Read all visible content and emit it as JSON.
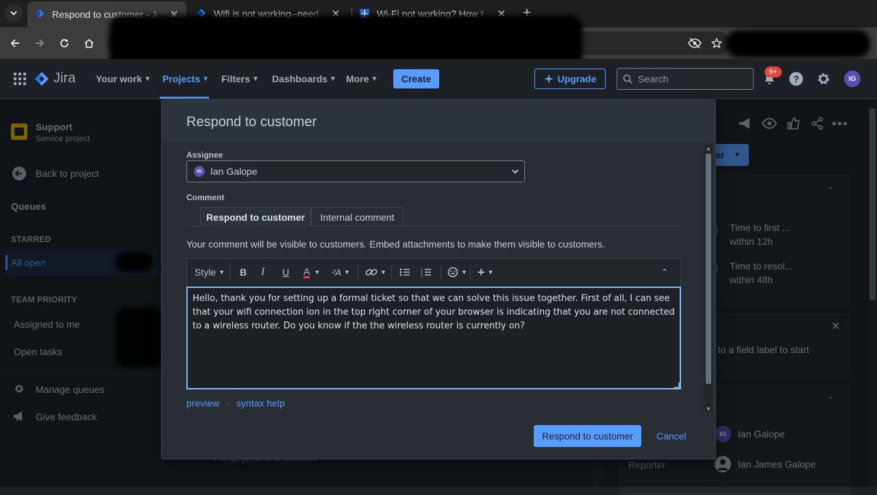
{
  "browser": {
    "tabs": [
      {
        "title": "Respond to customer - J",
        "active": true
      },
      {
        "title": "Wifi is not working--need",
        "active": false
      },
      {
        "title": "Wi-Fi not working? How t",
        "active": false
      }
    ],
    "new_tab": "+"
  },
  "topnav": {
    "logo": "Jira",
    "items": [
      {
        "label": "Your work",
        "active": false
      },
      {
        "label": "Projects",
        "active": true
      },
      {
        "label": "Filters",
        "active": false
      },
      {
        "label": "Dashboards",
        "active": false
      },
      {
        "label": "More",
        "active": false
      }
    ],
    "create": "Create",
    "upgrade": "Upgrade",
    "search_placeholder": "Search",
    "notification_count": "9+",
    "user_initials": "IG"
  },
  "sidebar": {
    "project_name": "Support",
    "project_type": "Service project",
    "back": "Back to project",
    "queues": "Queues",
    "starred_heading": "STARRED",
    "all_open": "All open",
    "team_heading": "TEAM PRIORITY",
    "assigned": "Assigned to me",
    "open_tasks": "Open tasks",
    "manage": "Manage queues",
    "feedback": "Give feedback"
  },
  "issue_panel": {
    "status_fragment": "er",
    "sla1_title": "Time to first ...",
    "sla1_value": "within 12h",
    "sla2_title": "Time to resol...",
    "sla2_value": "within 48h",
    "tip_fragment": "t to a field label to start",
    "assignee_name": "Ian Galope",
    "assignee_initials": "IG",
    "reporter_label": "Reporter",
    "reporter_name": "Ian James Galope",
    "pro_tip": "Pro tip: press M to comment"
  },
  "modal": {
    "title": "Respond to customer",
    "assignee_label": "Assignee",
    "assignee_value": "Ian Galope",
    "assignee_initials": "IG",
    "comment_label": "Comment",
    "tabs": [
      "Respond to customer",
      "Internal comment"
    ],
    "notice": "Your comment will be visible to customers. Embed attachments to make them visible to customers.",
    "toolbar": {
      "style": "Style"
    },
    "comment_text": "Hello, thank you for setting up a formal ticket so that we can solve this issue together. First of all, I can see that your wifi connection ion in the top right corner of your browser is indicating that you are not connected to a wireless router. Do you know if the the wireless router is currently on?",
    "preview": "preview",
    "syntax_help": "syntax help",
    "separator": "·",
    "submit": "Respond to customer",
    "cancel": "Cancel"
  },
  "colors": {
    "accent": "#579dff",
    "background": "#1d2125",
    "modal": "#282e33",
    "badge": "#e2483d"
  }
}
